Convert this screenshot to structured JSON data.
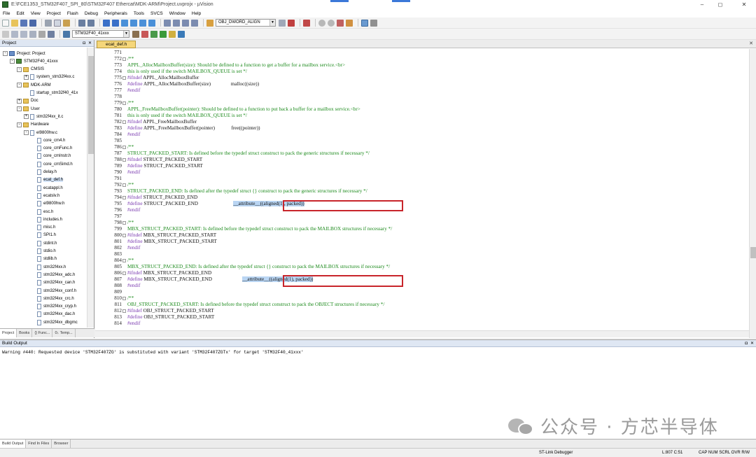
{
  "window": {
    "title": "E:\\FCE1353_STM32F407_SPI_80\\STM32F407 Ethercat\\MDK-ARM\\Project.uvprojx - µVision",
    "min": "–",
    "max": "◻",
    "close": "✕"
  },
  "menu": [
    "File",
    "Edit",
    "View",
    "Project",
    "Flash",
    "Debug",
    "Peripherals",
    "Tools",
    "SVCS",
    "Window",
    "Help"
  ],
  "toolbar": {
    "align_combo": "OBJ_DWORD_ALIGN",
    "target_combo": "STM32F40_41xxx"
  },
  "project_panel": {
    "title": "Project",
    "tree": [
      {
        "label": "Project: Project",
        "depth": 0,
        "kind": "root",
        "exp": "-"
      },
      {
        "label": "STM32F40_41xxx",
        "depth": 1,
        "kind": "proj",
        "exp": "-"
      },
      {
        "label": "CMSIS",
        "depth": 2,
        "kind": "folder",
        "exp": "-"
      },
      {
        "label": "system_stm32f4xx.c",
        "depth": 3,
        "kind": "file",
        "exp": "+"
      },
      {
        "label": "MDK-ARM",
        "depth": 2,
        "kind": "folder",
        "exp": "-"
      },
      {
        "label": "startup_stm32f40_41x",
        "depth": 3,
        "kind": "file",
        "exp": ""
      },
      {
        "label": "Doc",
        "depth": 2,
        "kind": "folder",
        "exp": "+"
      },
      {
        "label": "User",
        "depth": 2,
        "kind": "folder",
        "exp": "-"
      },
      {
        "label": "stm32f4xx_it.c",
        "depth": 3,
        "kind": "file",
        "exp": "+"
      },
      {
        "label": "Hardware",
        "depth": 2,
        "kind": "folder",
        "exp": "-"
      },
      {
        "label": "el9800hw.c",
        "depth": 3,
        "kind": "file",
        "exp": "-"
      },
      {
        "label": "core_cm4.h",
        "depth": 4,
        "kind": "file",
        "exp": ""
      },
      {
        "label": "core_cmFunc.h",
        "depth": 4,
        "kind": "file",
        "exp": ""
      },
      {
        "label": "core_cmInstr.h",
        "depth": 4,
        "kind": "file",
        "exp": ""
      },
      {
        "label": "core_cmSimd.h",
        "depth": 4,
        "kind": "file",
        "exp": ""
      },
      {
        "label": "delay.h",
        "depth": 4,
        "kind": "file",
        "exp": ""
      },
      {
        "label": "ecat_def.h",
        "depth": 4,
        "kind": "file",
        "exp": "",
        "selected": true
      },
      {
        "label": "ecatappl.h",
        "depth": 4,
        "kind": "file",
        "exp": ""
      },
      {
        "label": "ecatslv.h",
        "depth": 4,
        "kind": "file",
        "exp": ""
      },
      {
        "label": "el9800hw.h",
        "depth": 4,
        "kind": "file",
        "exp": ""
      },
      {
        "label": "esc.h",
        "depth": 4,
        "kind": "file",
        "exp": ""
      },
      {
        "label": "includes.h",
        "depth": 4,
        "kind": "file",
        "exp": ""
      },
      {
        "label": "misc.h",
        "depth": 4,
        "kind": "file",
        "exp": ""
      },
      {
        "label": "SPI1.h",
        "depth": 4,
        "kind": "file",
        "exp": ""
      },
      {
        "label": "stdint.h",
        "depth": 4,
        "kind": "file",
        "exp": ""
      },
      {
        "label": "stdio.h",
        "depth": 4,
        "kind": "file",
        "exp": ""
      },
      {
        "label": "stdlib.h",
        "depth": 4,
        "kind": "file",
        "exp": ""
      },
      {
        "label": "stm32f4xx.h",
        "depth": 4,
        "kind": "file",
        "exp": ""
      },
      {
        "label": "stm32f4xx_adc.h",
        "depth": 4,
        "kind": "file",
        "exp": ""
      },
      {
        "label": "stm32f4xx_can.h",
        "depth": 4,
        "kind": "file",
        "exp": ""
      },
      {
        "label": "stm32f4xx_conf.h",
        "depth": 4,
        "kind": "file",
        "exp": ""
      },
      {
        "label": "stm32f4xx_crc.h",
        "depth": 4,
        "kind": "file",
        "exp": ""
      },
      {
        "label": "stm32f4xx_cryp.h",
        "depth": 4,
        "kind": "file",
        "exp": ""
      },
      {
        "label": "stm32f4xx_dac.h",
        "depth": 4,
        "kind": "file",
        "exp": ""
      },
      {
        "label": "stm32f4xx_dbgmc",
        "depth": 4,
        "kind": "file",
        "exp": ""
      }
    ],
    "tabs": [
      "Project",
      "Books",
      "{} Func...",
      "0↓ Temp..."
    ]
  },
  "editor": {
    "tab": "ecat_def.h",
    "lines": [
      {
        "n": "771",
        "fold": "",
        "parts": [
          [
            "",
            "n"
          ]
        ]
      },
      {
        "n": "772",
        "fold": "box",
        "parts": [
          [
            "/**",
            "c"
          ]
        ]
      },
      {
        "n": "773",
        "fold": "",
        "parts": [
          [
            "APPL_AllocMailboxBuffer(size): Should be defined to a function to get a buffer for a mailbox service.<br>",
            "c"
          ]
        ]
      },
      {
        "n": "774",
        "fold": "",
        "parts": [
          [
            "this is only used if the switch MAILBOX_QUEUE is set */",
            "c"
          ]
        ]
      },
      {
        "n": "775",
        "fold": "box",
        "parts": [
          [
            "#ifndef ",
            "p"
          ],
          [
            "APPL_AllocMailboxBuffer",
            "n"
          ]
        ]
      },
      {
        "n": "776",
        "fold": "",
        "parts": [
          [
            "#define ",
            "p"
          ],
          [
            "APPL_AllocMailboxBuffer(size)                malloc((size))",
            "n"
          ]
        ]
      },
      {
        "n": "777",
        "fold": "",
        "parts": [
          [
            "#endif",
            "p"
          ]
        ]
      },
      {
        "n": "778",
        "fold": "",
        "parts": [
          [
            "",
            "n"
          ]
        ]
      },
      {
        "n": "779",
        "fold": "box",
        "parts": [
          [
            "/**",
            "c"
          ]
        ]
      },
      {
        "n": "780",
        "fold": "",
        "parts": [
          [
            "APPL_FreeMailboxBuffer(pointer): Should be defined to a function to put back a buffer for a mailbox service.<br>",
            "c"
          ]
        ]
      },
      {
        "n": "781",
        "fold": "",
        "parts": [
          [
            "this is only used if the switch MAILBOX_QUEUE is set */",
            "c"
          ]
        ]
      },
      {
        "n": "782",
        "fold": "box",
        "parts": [
          [
            "#ifndef ",
            "p"
          ],
          [
            "APPL_FreeMailboxBuffer",
            "n"
          ]
        ]
      },
      {
        "n": "783",
        "fold": "",
        "parts": [
          [
            "#define ",
            "p"
          ],
          [
            "APPL_FreeMailboxBuffer(pointer)             free((pointer))",
            "n"
          ]
        ]
      },
      {
        "n": "784",
        "fold": "",
        "parts": [
          [
            "#endif",
            "p"
          ]
        ]
      },
      {
        "n": "785",
        "fold": "",
        "parts": [
          [
            "",
            "n"
          ]
        ]
      },
      {
        "n": "786",
        "fold": "box",
        "parts": [
          [
            "/**",
            "c"
          ]
        ]
      },
      {
        "n": "787",
        "fold": "",
        "parts": [
          [
            "STRUCT_PACKED_START: Is defined before the typedef struct construct to pack the generic structures if necessary */",
            "c"
          ]
        ]
      },
      {
        "n": "788",
        "fold": "box",
        "parts": [
          [
            "#ifndef ",
            "p"
          ],
          [
            "STRUCT_PACKED_START",
            "n"
          ]
        ]
      },
      {
        "n": "789",
        "fold": "",
        "parts": [
          [
            "#define ",
            "p"
          ],
          [
            "STRUCT_PACKED_START",
            "n"
          ]
        ]
      },
      {
        "n": "790",
        "fold": "",
        "parts": [
          [
            "#endif",
            "p"
          ]
        ]
      },
      {
        "n": "791",
        "fold": "",
        "parts": [
          [
            "",
            "n"
          ]
        ]
      },
      {
        "n": "792",
        "fold": "box",
        "parts": [
          [
            "/**",
            "c"
          ]
        ]
      },
      {
        "n": "793",
        "fold": "",
        "parts": [
          [
            "STRUCT_PACKED_END: Is defined after the typedef struct {} construct to pack the generic structures if necessary */",
            "c"
          ]
        ]
      },
      {
        "n": "794",
        "fold": "box",
        "parts": [
          [
            "#ifndef ",
            "p"
          ],
          [
            "STRUCT_PACKED_END",
            "n"
          ]
        ]
      },
      {
        "n": "795",
        "fold": "",
        "parts": [
          [
            "#define ",
            "p"
          ],
          [
            "STRUCT_PACKED_END                            ",
            "n"
          ],
          [
            "__attribute__((aligned(1), packed))",
            "h"
          ]
        ]
      },
      {
        "n": "796",
        "fold": "",
        "parts": [
          [
            "#endif",
            "p"
          ]
        ]
      },
      {
        "n": "797",
        "fold": "",
        "parts": [
          [
            "",
            "n"
          ]
        ]
      },
      {
        "n": "798",
        "fold": "box",
        "parts": [
          [
            "/**",
            "c"
          ]
        ]
      },
      {
        "n": "799",
        "fold": "",
        "parts": [
          [
            "MBX_STRUCT_PACKED_START: Is defined before the typedef struct construct to pack the MAILBOX structures if necessary */",
            "c"
          ]
        ]
      },
      {
        "n": "800",
        "fold": "box",
        "parts": [
          [
            "#ifndef ",
            "p"
          ],
          [
            "MBX_STRUCT_PACKED_START",
            "n"
          ]
        ]
      },
      {
        "n": "801",
        "fold": "",
        "parts": [
          [
            "#define ",
            "p"
          ],
          [
            "MBX_STRUCT_PACKED_START",
            "n"
          ]
        ]
      },
      {
        "n": "802",
        "fold": "",
        "parts": [
          [
            "#endif",
            "p"
          ]
        ]
      },
      {
        "n": "803",
        "fold": "",
        "parts": [
          [
            "",
            "n"
          ]
        ]
      },
      {
        "n": "804",
        "fold": "box",
        "parts": [
          [
            "/**",
            "c"
          ]
        ]
      },
      {
        "n": "805",
        "fold": "",
        "parts": [
          [
            "MBX_STRUCT_PACKED_END: Is defined after the typedef struct {} construct to pack the MAILBOX structures if necessary */",
            "c"
          ]
        ]
      },
      {
        "n": "806",
        "fold": "box",
        "parts": [
          [
            "#ifndef ",
            "p"
          ],
          [
            "MBX_STRUCT_PACKED_END",
            "n"
          ]
        ]
      },
      {
        "n": "807",
        "fold": "",
        "parts": [
          [
            "#define ",
            "p"
          ],
          [
            "MBX_STRUCT_PACKED_END                        ",
            "n"
          ],
          [
            "__attribute__((aligned(1), packed))",
            "h"
          ]
        ]
      },
      {
        "n": "808",
        "fold": "",
        "parts": [
          [
            "#endif",
            "p"
          ]
        ]
      },
      {
        "n": "809",
        "fold": "",
        "parts": [
          [
            "",
            "n"
          ]
        ]
      },
      {
        "n": "810",
        "fold": "box",
        "parts": [
          [
            "/**",
            "c"
          ]
        ]
      },
      {
        "n": "811",
        "fold": "",
        "parts": [
          [
            "OBJ_STRUCT_PACKED_START: Is defined before the typedef struct construct to pack the OBJECT structures if necessary */",
            "c"
          ]
        ]
      },
      {
        "n": "812",
        "fold": "box",
        "parts": [
          [
            "#ifndef ",
            "p"
          ],
          [
            "OBJ_STRUCT_PACKED_START",
            "n"
          ]
        ]
      },
      {
        "n": "813",
        "fold": "",
        "parts": [
          [
            "#define ",
            "p"
          ],
          [
            "OBJ_STRUCT_PACKED_START",
            "n"
          ]
        ]
      },
      {
        "n": "814",
        "fold": "",
        "parts": [
          [
            "#endif",
            "p"
          ]
        ]
      }
    ]
  },
  "build_output": {
    "title": "Build Output",
    "text": "Warning #440: Requested device 'STM32F407ZG' is substituted with variant 'STM32F407ZGTx' for target 'STM32F40_41xxx'",
    "tabs": [
      "Build Output",
      "Find In Files",
      "Browser"
    ]
  },
  "status": {
    "debugger": "ST-Link Debugger",
    "position": "L:807 C:51",
    "flags": "CAP NUM SCRL OVR R/W"
  },
  "watermark": "公众号 · 方芯半导体",
  "colors": {
    "comment": "#1c8a1c",
    "preprocessor": "#7a3ab0",
    "highlight": "#b9d5f3",
    "annotation_box": "#c8252b"
  }
}
